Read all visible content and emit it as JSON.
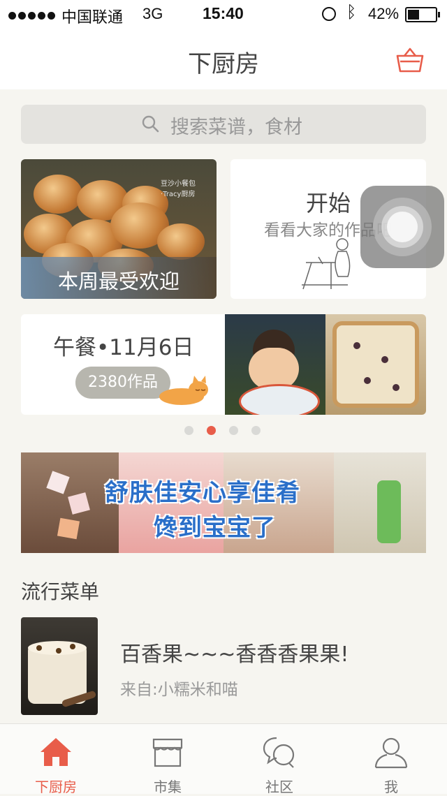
{
  "status_bar": {
    "carrier": "中国联通",
    "network": "3G",
    "time": "15:40",
    "battery": "42%",
    "battery_level": 0.42
  },
  "nav": {
    "title": "下厨房",
    "icons": [
      "basket-icon"
    ]
  },
  "search": {
    "placeholder": "搜索菜谱，食材",
    "icon": "search-icon"
  },
  "cards": {
    "popular": {
      "caption": "本周最受欢迎",
      "watermark": "豆沙小餐包 ·Tracy厨房"
    },
    "start": {
      "title": "开始",
      "subtitle": "看看大家的作品吧"
    },
    "lunch": {
      "title": "午餐•11月6日",
      "works": "2380作品"
    }
  },
  "pager": {
    "count": 4,
    "active": 1
  },
  "banner": {
    "line1": "舒肤佳安心享佳肴",
    "line2": "馋到宝宝了"
  },
  "section": {
    "title": "流行菜单"
  },
  "recipe": {
    "title": "百香果~~~香香香果果!",
    "author": "来自:小糯米和喵"
  },
  "tabs": [
    {
      "label": "下厨房",
      "icon": "home-icon",
      "active": true
    },
    {
      "label": "市集",
      "icon": "market-icon",
      "active": false
    },
    {
      "label": "社区",
      "icon": "chat-bubbles-icon",
      "active": false
    },
    {
      "label": "我",
      "icon": "person-icon",
      "active": false
    }
  ],
  "colors": {
    "accent": "#e85d4a",
    "background": "#f6f5f0",
    "banner_text": "#2a6fc9"
  }
}
